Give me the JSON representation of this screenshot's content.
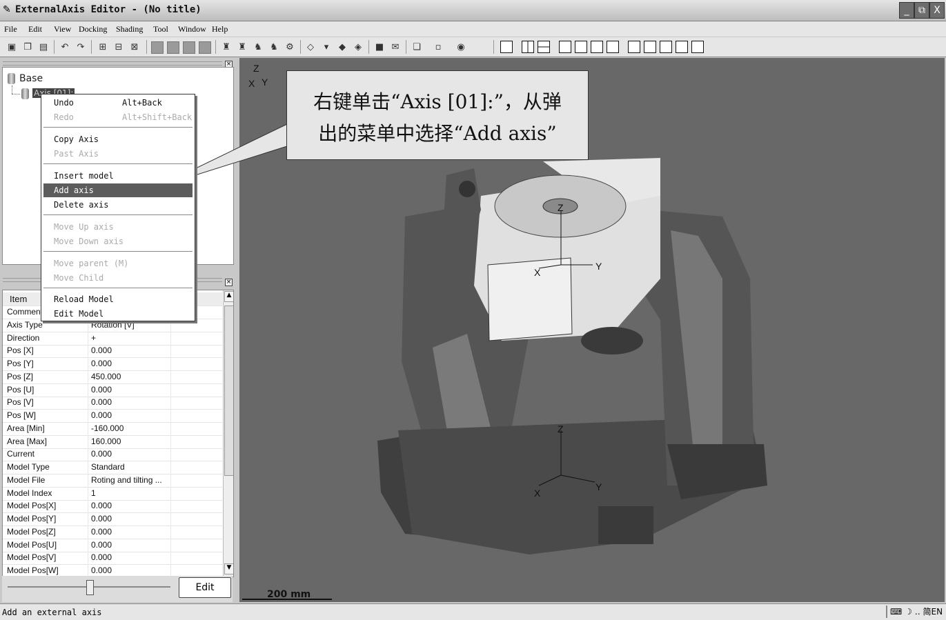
{
  "window": {
    "title": "ExternalAxis Editor - (No title)",
    "icon": "app-icon",
    "buttons": [
      "_",
      "⧉",
      "X"
    ]
  },
  "menubar": {
    "items": [
      "File",
      "Edit",
      "View",
      "Docking",
      "Shading",
      "Tool",
      "Window",
      "Help"
    ]
  },
  "tree": {
    "root": "Base",
    "child": "Axis [01]:"
  },
  "context_menu": {
    "items": [
      {
        "label": "Undo",
        "shortcut": "Alt+Back",
        "enabled": true
      },
      {
        "label": "Redo",
        "shortcut": "Alt+Shift+Back",
        "enabled": false
      },
      {
        "label": "Copy Axis",
        "enabled": true
      },
      {
        "label": "Past Axis",
        "enabled": false
      },
      {
        "label": "Insert model",
        "enabled": true
      },
      {
        "label": "Add axis",
        "enabled": true,
        "highlighted": true
      },
      {
        "label": "Delete axis",
        "enabled": true
      },
      {
        "label": "Move Up axis",
        "enabled": false
      },
      {
        "label": "Move Down axis",
        "enabled": false
      },
      {
        "label": "Move parent (M)",
        "enabled": false
      },
      {
        "label": "Move Child",
        "enabled": false
      },
      {
        "label": "Reload Model",
        "enabled": true
      },
      {
        "label": "Edit Model",
        "enabled": true
      }
    ]
  },
  "properties": {
    "header": "Item",
    "rows": [
      {
        "key": "Comment",
        "value": ""
      },
      {
        "key": "Axis Type",
        "value": "Rotation [V]"
      },
      {
        "key": "Direction",
        "value": "+"
      },
      {
        "key": "Pos [X]",
        "value": "0.000"
      },
      {
        "key": "Pos [Y]",
        "value": "0.000"
      },
      {
        "key": "Pos [Z]",
        "value": "450.000"
      },
      {
        "key": "Pos [U]",
        "value": "0.000"
      },
      {
        "key": "Pos [V]",
        "value": "0.000"
      },
      {
        "key": "Pos [W]",
        "value": "0.000"
      },
      {
        "key": "Area [Min]",
        "value": "-160.000"
      },
      {
        "key": "Area [Max]",
        "value": "160.000"
      },
      {
        "key": "Current",
        "value": "0.000"
      },
      {
        "key": "Model Type",
        "value": "Standard"
      },
      {
        "key": "Model File",
        "value": "Roting and tilting ..."
      },
      {
        "key": "Model Index",
        "value": "1"
      },
      {
        "key": "Model Pos[X]",
        "value": "0.000"
      },
      {
        "key": "Model Pos[Y]",
        "value": "0.000"
      },
      {
        "key": "Model Pos[Z]",
        "value": "0.000"
      },
      {
        "key": "Model Pos[U]",
        "value": "0.000"
      },
      {
        "key": "Model Pos[V]",
        "value": "0.000"
      },
      {
        "key": "Model Pos[W]",
        "value": "0.000"
      }
    ]
  },
  "edit_button": "Edit",
  "viewport": {
    "scale_label": "200 mm",
    "triad": {
      "z": "Z",
      "x": "X",
      "y": "Y"
    },
    "callout": {
      "line1": "右键单击“Axis [01]:”，从弹",
      "line2": "出的菜单中选择“Add axis”"
    }
  },
  "status": {
    "text": "Add an external axis",
    "ime": "简EN"
  }
}
